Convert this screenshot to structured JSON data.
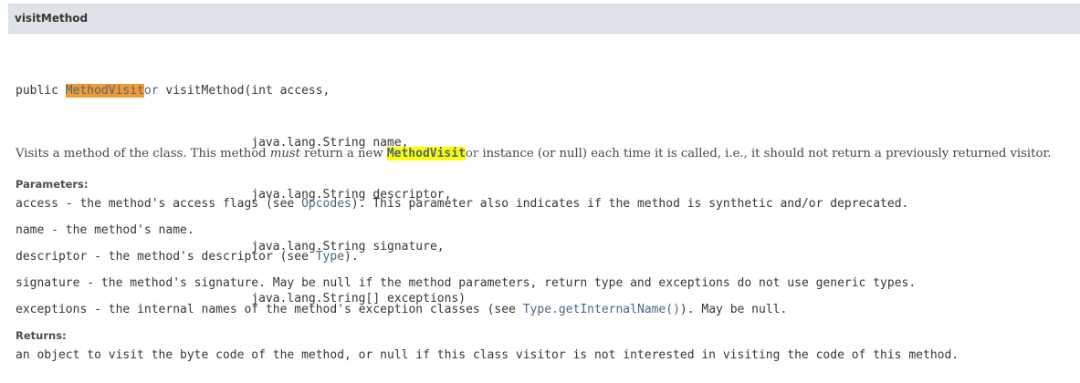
{
  "header": {
    "title": "visitMethod"
  },
  "signature": {
    "line1_prefix": "public ",
    "return_type_highlight": "MethodVisit",
    "return_type_rest": "or",
    "line1_suffix": " visitMethod(int access,",
    "indent": "                                 ",
    "line2": "java.lang.String name,",
    "line3": "java.lang.String descriptor,",
    "line4": "java.lang.String signature,",
    "line5": "java.lang.String[] exceptions)"
  },
  "description": {
    "part1": "Visits a method of the class. This method ",
    "emphasis": "must",
    "part2": " return a new ",
    "highlight": "MethodVisit",
    "highlight_rest": "or",
    "part3": " instance (or null) each time it is called, i.e., it should not return a previously returned visitor."
  },
  "parameters": {
    "label": "Parameters:",
    "items": [
      {
        "name": "access",
        "text_before": " - the method's access flags (see ",
        "link": "Opcodes",
        "text_after": "). This parameter also indicates if the method is synthetic and/or deprecated."
      },
      {
        "name": "name",
        "text_before": " - the method's name.",
        "link": "",
        "text_after": ""
      },
      {
        "name": "descriptor",
        "text_before": " - the method's descriptor (see ",
        "link": "Type",
        "text_after": ")."
      },
      {
        "name": "signature",
        "text_before": " - the method's signature. May be null if the method parameters, return type and exceptions do not use generic types.",
        "link": "",
        "text_after": ""
      },
      {
        "name": "exceptions",
        "text_before": " - the internal names of the method's exception classes (see ",
        "link": "Type.getInternalName()",
        "text_after": "). May be null."
      }
    ]
  },
  "returns": {
    "label": "Returns:",
    "text": "an object to visit the byte code of the method, or null if this class visitor is not interested in visiting the code of this method."
  },
  "colors": {
    "header_bg": "#dee3e9",
    "link": "#4a6782",
    "highlight_orange": "#f29b30",
    "highlight_yellow": "#ffff00"
  }
}
